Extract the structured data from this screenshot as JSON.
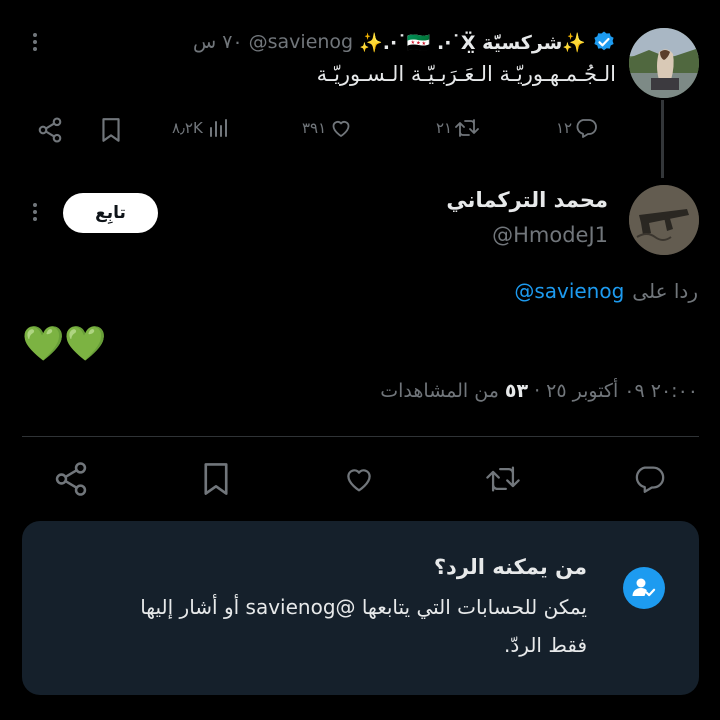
{
  "parent_tweet": {
    "display_name": "✨شركسيّة 🇸🇾 .·˙Ẍ̤˙·.✨",
    "handle": "@savienog",
    "time": "٧٠ س",
    "text": "الـجُـمـهـوريّـة الـعَـرَبـيّـة الـسـوريّـة",
    "replies": "١٢",
    "retweets": "٢١",
    "likes": "٣٩١",
    "views": "٨٫٢K"
  },
  "reply_tweet": {
    "display_name": "محمد التركماني",
    "handle": "@HmodeJ1",
    "follow_label": "تابِع",
    "replying_prefix": "ردا على",
    "replying_to": "@savienog",
    "text": "💚💚",
    "meta_time": "٢٠:٠٠ ٠٩ أكتوبر ٢٥",
    "meta_sep": "·",
    "views_count": "٥٣",
    "views_label": "من المشاهدات"
  },
  "reply_restriction": {
    "title": "من يمكنه الرد؟",
    "body_line1": "يمكن للحسابات التي يتابعها @savienog أو أشار إليها",
    "body_line2": "فقط الردّ."
  },
  "icons": {
    "verified": "verified-badge-icon",
    "share": "share-icon",
    "bookmark": "bookmark-icon",
    "views": "analytics-icon",
    "like": "heart-icon",
    "retweet": "retweet-icon",
    "reply": "reply-icon",
    "more": "more-dots-icon",
    "restriction": "person-check-icon"
  },
  "colors": {
    "background": "#000000",
    "text": "#e7e9ea",
    "muted": "#71767b",
    "accent": "#1d9bf0",
    "card": "#15202b"
  }
}
